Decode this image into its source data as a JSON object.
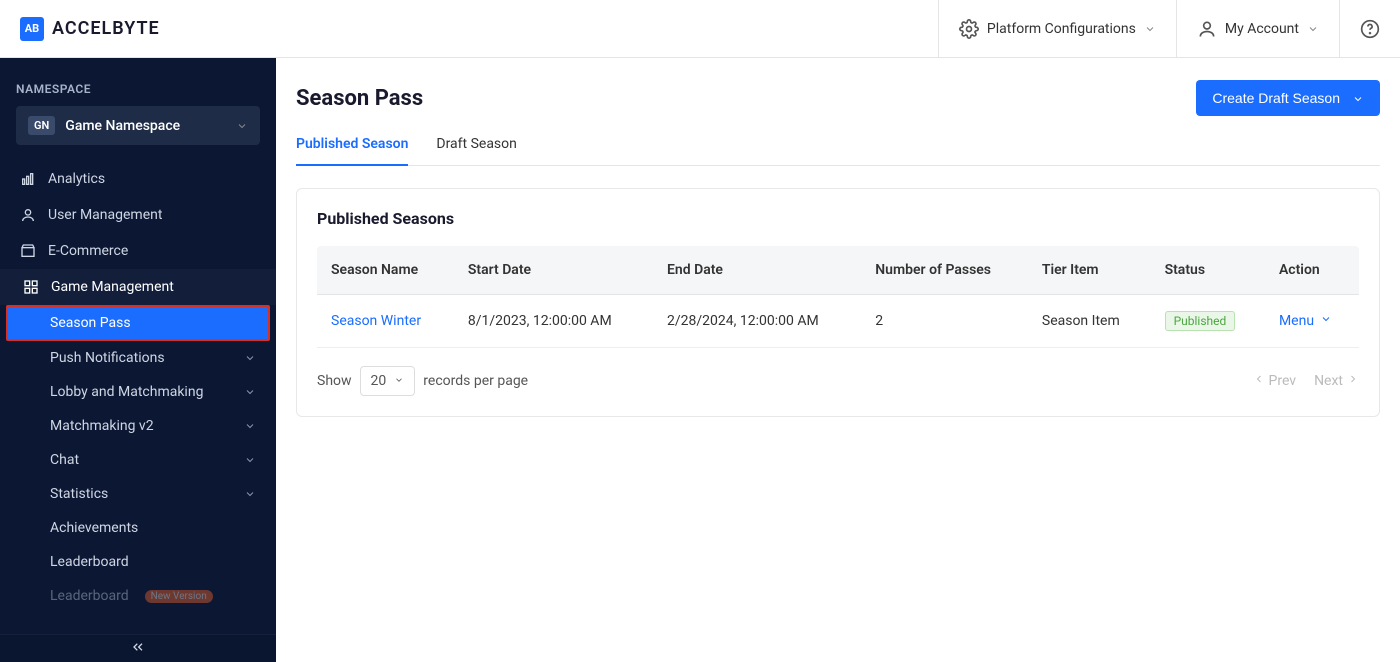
{
  "brand": {
    "badge": "AB",
    "name": "ACCELBYTE"
  },
  "header": {
    "platform": "Platform Configurations",
    "account": "My Account"
  },
  "sidebar": {
    "ns_label": "NAMESPACE",
    "ns_badge": "GN",
    "ns_name": "Game Namespace",
    "items": [
      {
        "label": "Analytics"
      },
      {
        "label": "User Management"
      },
      {
        "label": "E-Commerce"
      },
      {
        "label": "Game Management"
      }
    ],
    "subs": [
      {
        "label": "Season Pass",
        "selected": true
      },
      {
        "label": "Push Notifications",
        "chev": true
      },
      {
        "label": "Lobby and Matchmaking",
        "chev": true
      },
      {
        "label": "Matchmaking v2",
        "chev": true
      },
      {
        "label": "Chat",
        "chev": true
      },
      {
        "label": "Statistics",
        "chev": true
      },
      {
        "label": "Achievements"
      },
      {
        "label": "Leaderboard"
      },
      {
        "label": "Leaderboard",
        "pill": "New Version"
      }
    ]
  },
  "page": {
    "title": "Season Pass",
    "create_btn": "Create Draft Season",
    "tabs": {
      "active": "Published Season",
      "other": "Draft Season"
    },
    "panel_title": "Published Seasons",
    "columns": {
      "name": "Season Name",
      "start": "Start Date",
      "end": "End Date",
      "passes": "Number of Passes",
      "tier": "Tier Item",
      "status": "Status",
      "action": "Action"
    },
    "row": {
      "name": "Season Winter",
      "start": "8/1/2023, 12:00:00 AM",
      "end": "2/28/2024, 12:00:00 AM",
      "passes": "2",
      "tier": "Season Item",
      "status": "Published",
      "action": "Menu"
    },
    "pager": {
      "show": "Show",
      "value": "20",
      "records": "records per page",
      "prev": "Prev",
      "next": "Next"
    }
  }
}
